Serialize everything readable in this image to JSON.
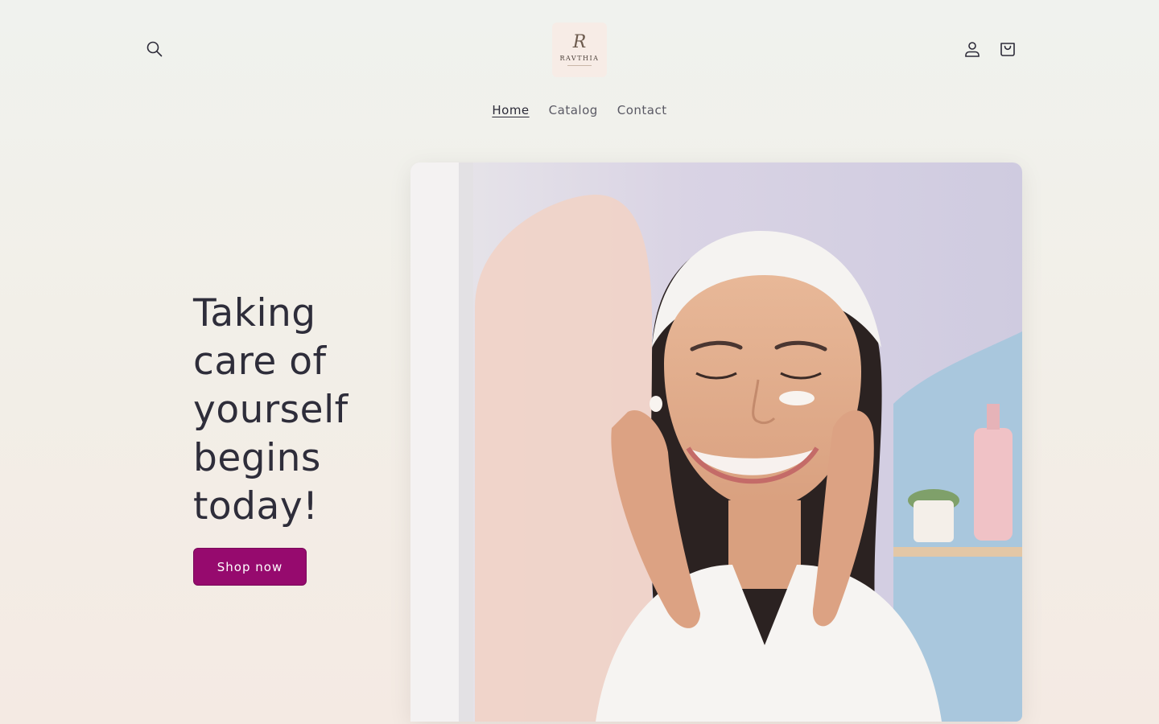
{
  "header": {
    "logo_text": "RAVTHIA",
    "logo_mark": "R",
    "search_icon": "search-icon",
    "account_icon": "account-icon",
    "cart_icon": "cart-icon"
  },
  "nav": {
    "items": [
      {
        "label": "Home",
        "active": true
      },
      {
        "label": "Catalog",
        "active": false
      },
      {
        "label": "Contact",
        "active": false
      }
    ]
  },
  "hero": {
    "heading_lines": [
      "Taking",
      "care of",
      "yourself",
      "begins",
      "today!"
    ],
    "button_label": "Shop now",
    "button_color": "#960a6e"
  }
}
